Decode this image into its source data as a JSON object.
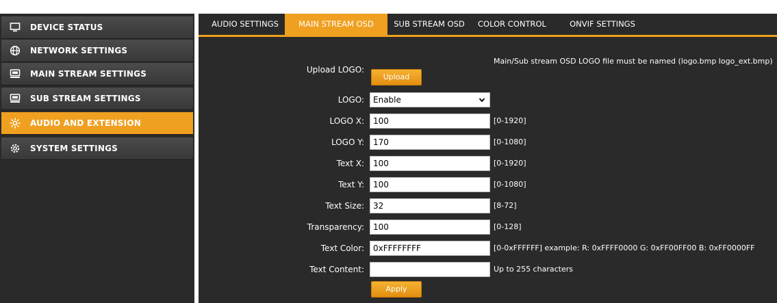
{
  "sidebar": {
    "items": [
      {
        "label": "DEVICE STATUS",
        "icon": "monitor-icon"
      },
      {
        "label": "NETWORK SETTINGS",
        "icon": "globe-icon"
      },
      {
        "label": "MAIN STREAM SETTINGS",
        "icon": "screen-icon"
      },
      {
        "label": "SUB STREAM SETTINGS",
        "icon": "screen-icon"
      },
      {
        "label": "AUDIO AND EXTENSION",
        "icon": "gear-sun-icon",
        "active": true
      },
      {
        "label": "SYSTEM SETTINGS",
        "icon": "gear-icon"
      }
    ]
  },
  "tabs": [
    {
      "label": "AUDIO SETTINGS"
    },
    {
      "label": "MAIN STREAM OSD",
      "active": true
    },
    {
      "label": "SUB STREAM OSD"
    },
    {
      "label": "COLOR CONTROL"
    },
    {
      "label": "ONVIF SETTINGS"
    }
  ],
  "form": {
    "upload_logo_label": "Upload LOGO:",
    "upload_button": "Upload",
    "logo_note": "Main/Sub stream OSD LOGO file must be named (logo.bmp logo_ext.bmp)",
    "logo_label": "LOGO:",
    "logo_value": "Enable",
    "logo_x_label": "LOGO X:",
    "logo_x_value": "100",
    "logo_x_hint": "[0-1920]",
    "logo_y_label": "LOGO Y:",
    "logo_y_value": "170",
    "logo_y_hint": "[0-1080]",
    "text_x_label": "Text X:",
    "text_x_value": "100",
    "text_x_hint": "[0-1920]",
    "text_y_label": "Text Y:",
    "text_y_value": "100",
    "text_y_hint": "[0-1080]",
    "text_size_label": "Text Size:",
    "text_size_value": "32",
    "text_size_hint": "[8-72]",
    "transparency_label": "Transparency:",
    "transparency_value": "100",
    "transparency_hint": "[0-128]",
    "text_color_label": "Text Color:",
    "text_color_value": "0xFFFFFFFF",
    "text_color_hint": "[0-0xFFFFFF] example: R: 0xFFFF0000 G: 0xFF00FF00 B: 0xFF0000FF",
    "text_content_label": "Text Content:",
    "text_content_value": "",
    "text_content_hint": "Up to 255 characters",
    "apply_button": "Apply"
  },
  "colors": {
    "accent": "#f0a020",
    "panel": "#2a2a2a"
  }
}
